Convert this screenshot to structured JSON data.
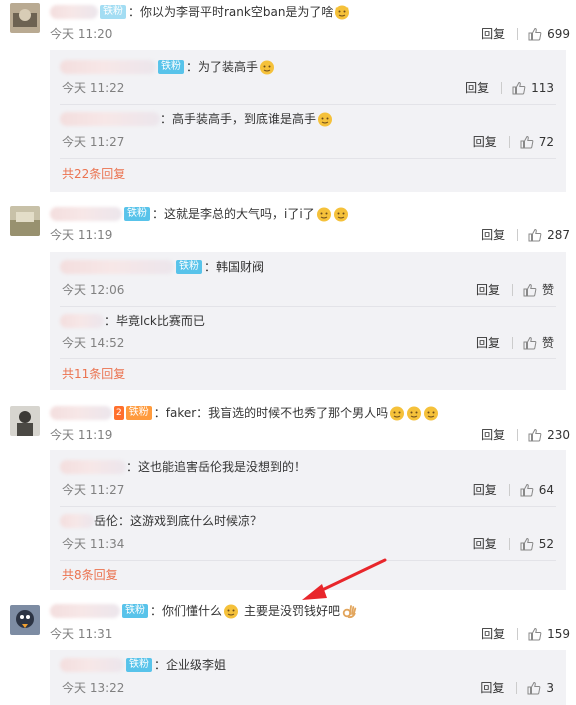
{
  "colors": {
    "accent_link": "#eb7350",
    "badge_blue": "#58c3ea",
    "sub_bg": "#f2f2f5",
    "arrow": "#e8262b"
  },
  "labels": {
    "reply": "回复",
    "badge_iron_fan": "铁粉",
    "badge_prefix": "2"
  },
  "comments": [
    {
      "text": "：你以为李哥平时rank空ban是为了啥",
      "time": "今天 11:20",
      "likes": "699",
      "subs": [
        {
          "text": "：为了装高手",
          "time": "今天 11:22",
          "likes": "113"
        },
        {
          "text": "：高手装高手，到底谁是高手",
          "time": "今天 11:27",
          "likes": "72"
        }
      ],
      "more": "共22条回复"
    },
    {
      "text": "：这就是李总的大气吗，i了i了",
      "time": "今天 11:19",
      "likes": "287",
      "subs": [
        {
          "text": "：韩国财阀",
          "time": "今天 12:06",
          "likes": "赞"
        },
        {
          "text": "：毕竟lck比赛而已",
          "time": "今天 14:52",
          "likes": "赞"
        }
      ],
      "more": "共11条回复"
    },
    {
      "text": "：faker：我盲选的时候不也秀了那个男人吗",
      "time": "今天 11:19",
      "likes": "230",
      "subs": [
        {
          "text": "：这也能追害岳伦我是没想到的！",
          "time": "今天 11:27",
          "likes": "64"
        },
        {
          "text": "岳伦：这游戏到底什么时候凉？",
          "time": "今天 11:34",
          "likes": "52"
        }
      ],
      "more": "共8条回复"
    },
    {
      "text": "：你们懂什么",
      "text2": "主要是没罚钱好吧",
      "time": "今天 11:31",
      "likes": "159",
      "subs": [
        {
          "text": "：企业级李姐",
          "time": "今天 13:22",
          "likes": "3"
        }
      ]
    }
  ]
}
